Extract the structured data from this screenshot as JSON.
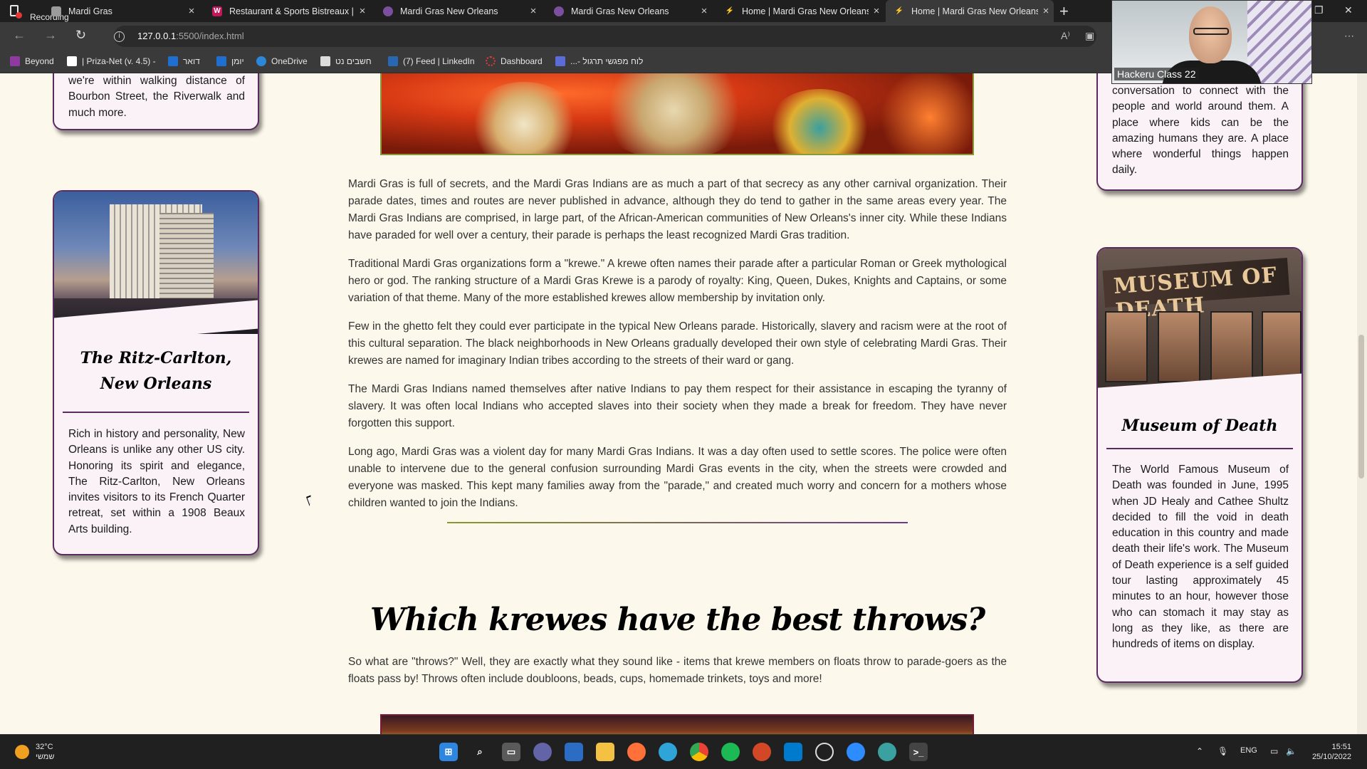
{
  "recording": {
    "label": "Recording"
  },
  "tabs": [
    {
      "title": "Mardi Gras",
      "favicon_color": "#9b9b9b",
      "favicon_letter": ""
    },
    {
      "title": "Restaurant & Sports Bistreaux | W",
      "favicon_color": "#c2185b",
      "favicon_letter": "W"
    },
    {
      "title": "Mardi Gras New Orleans",
      "favicon_color": "#7b4fa0",
      "favicon_letter": ""
    },
    {
      "title": "Mardi Gras New Orleans",
      "favicon_color": "#7b4fa0",
      "favicon_letter": ""
    },
    {
      "title": "Home | Mardi Gras New Orleans",
      "favicon_color": "#d4b800",
      "favicon_letter": ""
    },
    {
      "title": "Home | Mardi Gras New Orleans",
      "favicon_color": "#d4b800",
      "favicon_letter": ""
    }
  ],
  "address": {
    "host": "127.0.0.1",
    "path": ":5500/index.html"
  },
  "bookmarks": [
    {
      "label": "Beyond",
      "color": "#8e3aa0"
    },
    {
      "label": "| Priza-Net (v. 4.5) -",
      "color": "#ffffff"
    },
    {
      "label": "דואר",
      "color": "#1f6fd0"
    },
    {
      "label": "יומן",
      "color": "#1f6fd0"
    },
    {
      "label": "OneDrive",
      "color": "#2b88d8"
    },
    {
      "label": "חשבים נט",
      "color": "#dcdcdc"
    },
    {
      "label": "(7) Feed | LinkedIn",
      "color": "#2867b2"
    },
    {
      "label": "Dashboard",
      "color": "#e53935"
    },
    {
      "label": "...- לוח מפגשי תרגול",
      "color": "#5b6cd8"
    }
  ],
  "left_card_top": {
    "text": "we're within walking distance of Bourbon Street, the Riverwalk and much more."
  },
  "hotel_card": {
    "title": "The Ritz-Carlton, New Orleans",
    "text": "Rich in history and personality, New Orleans is unlike any other US city. Honoring its spirit and elegance, The Ritz-Carlton, New Orleans invites visitors to its French Quarter retreat, set within a 1908 Beaux Arts building."
  },
  "right_card_top": {
    "text": "conversation to connect with the people and world around them. A place where kids can be the amazing humans they are. A place where wonderful things happen daily."
  },
  "museum_card": {
    "sign": "MUSEUM OF DEATH",
    "title": "Museum of Death",
    "text": "The World Famous Museum of Death was founded in June, 1995 when JD Healy and Cathee Shultz decided to fill the void in death education in this country and made death their life's work. The Museum of Death experience is a self guided tour lasting approximately 45 minutes to an hour, however those who can stomach it may stay as long as they like, as there are hundreds of items on display."
  },
  "main": {
    "paragraphs": [
      "Mardi Gras is full of secrets, and the Mardi Gras Indians are as much a part of that secrecy as any other carnival organization. Their parade dates, times and routes are never published in advance, although they do tend to gather in the same areas every year. The Mardi Gras Indians are comprised, in large part, of the African-American communities of New Orleans's inner city. While these Indians have paraded for well over a century, their parade is perhaps the least recognized Mardi Gras tradition.",
      "Traditional Mardi Gras organizations form a \"krewe.\" A krewe often names their parade after a particular Roman or Greek mythological hero or god. The ranking structure of a Mardi Gras Krewe is a parody of royalty: King, Queen, Dukes, Knights and Captains, or some variation of that theme. Many of the more established krewes allow membership by invitation only.",
      "Few in the ghetto felt they could ever participate in the typical New Orleans parade. Historically, slavery and racism were at the root of this cultural separation. The black neighborhoods in New Orleans gradually developed their own style of celebrating Mardi Gras. Their krewes are named for imaginary Indian tribes according to the streets of their ward or gang.",
      "The Mardi Gras Indians named themselves after native Indians to pay them respect for their assistance in escaping the tyranny of slavery. It was often local Indians who accepted slaves into their society when they made a break for freedom. They have never forgotten this support.",
      "Long ago, Mardi Gras was a violent day for many Mardi Gras Indians. It was a day often used to settle scores. The police were often unable to intervene due to the general confusion surrounding Mardi Gras events in the city, when the streets were crowded and everyone was masked. This kept many families away from the \"parade,\" and created much worry and concern for a mothers whose children wanted to join the Indians."
    ],
    "section_heading": "Which krewes have the best throws?",
    "section_text": "So what are \"throws?\" Well, they are exactly what they sound like - items that krewe members on floats throw to parade-goers as the floats pass by! Throws often include doubloons, beads, cups, homemade trinkets, toys and more!"
  },
  "webcam": {
    "label": "Hackeru Class 22"
  },
  "taskbar": {
    "weather_temp": "32°C",
    "weather_desc": "שמשי",
    "lang": "ENG",
    "time": "15:51",
    "date": "25/10/2022"
  }
}
